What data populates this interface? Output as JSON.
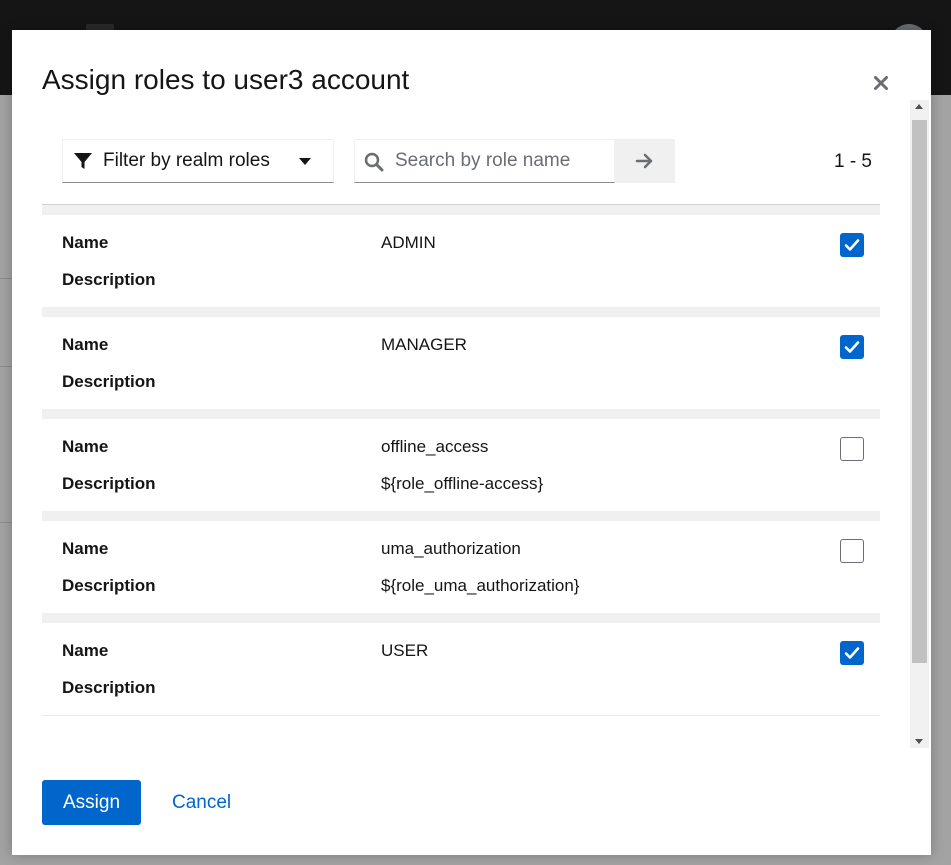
{
  "background_page": {
    "logo_icon": "product-logo-icon",
    "avatar_icon": "user-avatar-icon"
  },
  "modal": {
    "title": "Assign roles to user3 account",
    "close_icon": "close-icon"
  },
  "toolbar": {
    "filter": {
      "icon": "filter-icon",
      "selected": "Filter by realm roles",
      "caret_icon": "caret-down-icon"
    },
    "search": {
      "icon": "search-icon",
      "placeholder": "Search by role name",
      "value": "",
      "submit_icon": "arrow-right-icon"
    },
    "pagination": "1 - 5"
  },
  "columns": {
    "name_label": "Name",
    "description_label": "Description"
  },
  "roles": [
    {
      "name": "ADMIN",
      "description": "",
      "selected": true
    },
    {
      "name": "MANAGER",
      "description": "",
      "selected": true
    },
    {
      "name": "offline_access",
      "description": "${role_offline-access}",
      "selected": false
    },
    {
      "name": "uma_authorization",
      "description": "${role_uma_authorization}",
      "selected": false
    },
    {
      "name": "USER",
      "description": "",
      "selected": true
    }
  ],
  "footer": {
    "assign_label": "Assign",
    "cancel_label": "Cancel"
  },
  "colors": {
    "primary": "#0066cc",
    "header_bg": "#151515",
    "overlay": "#a3a3a3",
    "card_separator": "#f0f0f0",
    "text": "#151515"
  }
}
